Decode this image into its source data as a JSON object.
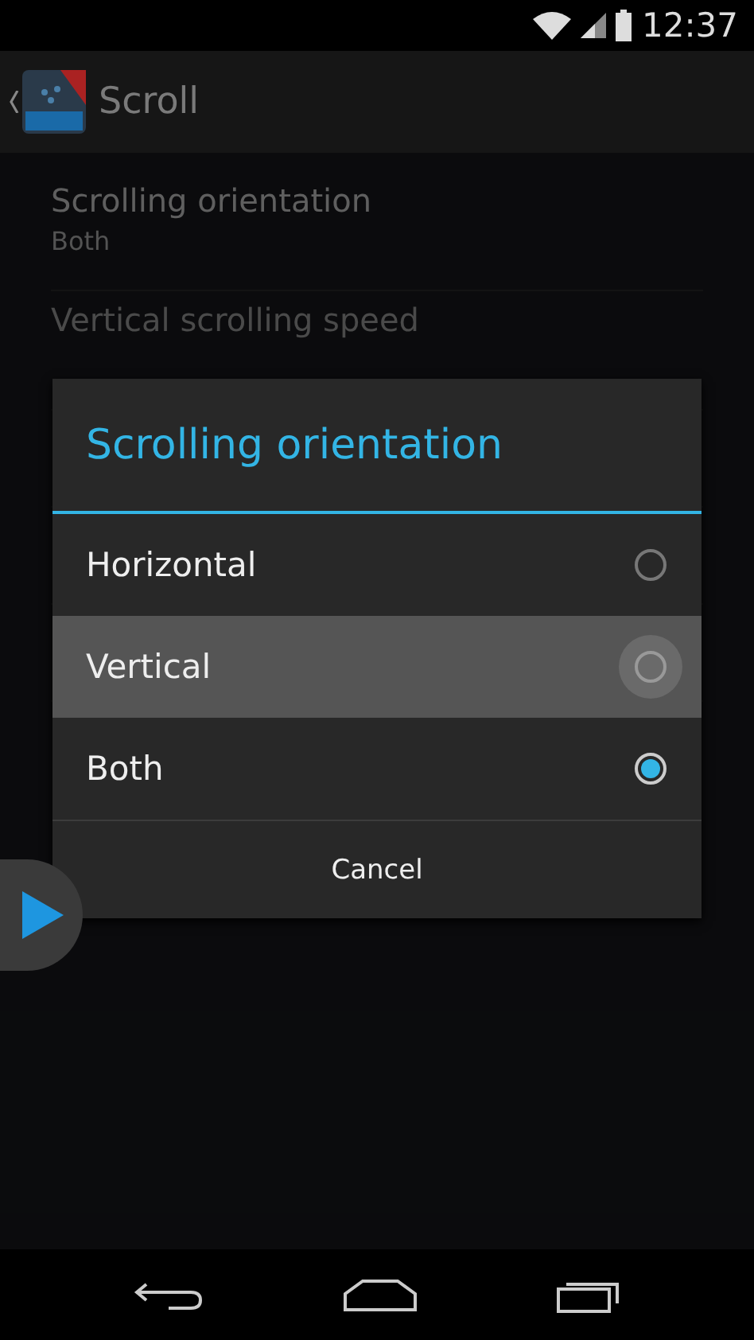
{
  "status_bar": {
    "time": "12:37"
  },
  "action_bar": {
    "title": "Scroll"
  },
  "settings": [
    {
      "title": "Scrolling orientation",
      "summary": "Both",
      "disabled": false
    },
    {
      "title": "Vertical scrolling speed",
      "disabled": true
    }
  ],
  "dialog": {
    "title": "Scrolling orientation",
    "options": [
      {
        "label": "Horizontal",
        "selected": false,
        "pressed": false
      },
      {
        "label": "Vertical",
        "selected": false,
        "pressed": true
      },
      {
        "label": "Both",
        "selected": true,
        "pressed": false
      }
    ],
    "buttons": [
      "Cancel"
    ]
  }
}
